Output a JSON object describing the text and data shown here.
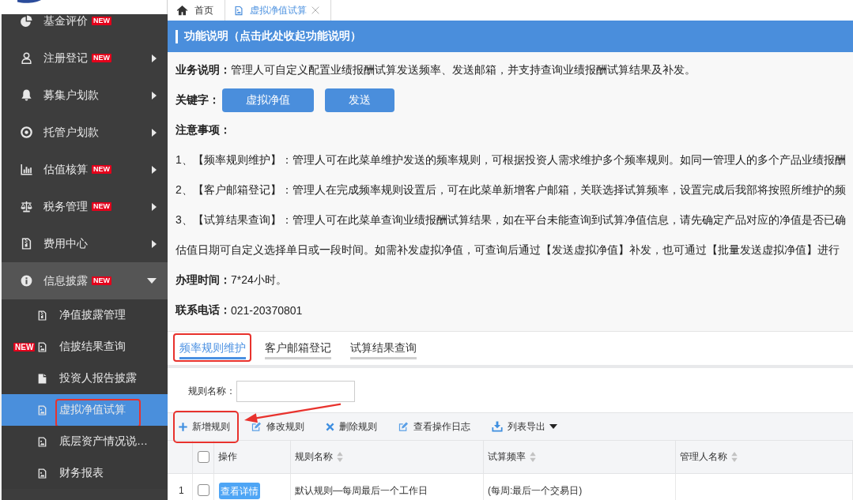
{
  "sidebar": {
    "items": [
      {
        "label": "基金评价",
        "badge": "NEW",
        "kind": "link",
        "expanded": false,
        "selected": false
      },
      {
        "label": "注册登记",
        "badge": "NEW",
        "kind": "group",
        "expanded": false,
        "selected": false
      },
      {
        "label": "募集户划款",
        "kind": "group",
        "expanded": false,
        "selected": false
      },
      {
        "label": "托管户划款",
        "kind": "group",
        "expanded": false,
        "selected": false
      },
      {
        "label": "估值核算",
        "badge": "NEW",
        "kind": "group",
        "expanded": false,
        "selected": false
      },
      {
        "label": "税务管理",
        "badge": "NEW",
        "kind": "group",
        "expanded": false,
        "selected": false
      },
      {
        "label": "费用中心",
        "kind": "group",
        "expanded": false,
        "selected": false
      },
      {
        "label": "信息披露",
        "badge": "NEW",
        "kind": "group",
        "expanded": true,
        "selected": false,
        "children": [
          {
            "label": "净值披露管理",
            "selected": false,
            "marked": false
          },
          {
            "label": "信披结果查询",
            "badge": "NEW",
            "selected": false,
            "marked": false
          },
          {
            "label": "投资人报告披露",
            "selected": false,
            "marked": false
          },
          {
            "label": "虚拟净值试算",
            "selected": true,
            "marked": true
          },
          {
            "label": "底层资产情况说…",
            "selected": false,
            "marked": false
          },
          {
            "label": "财务报表",
            "selected": false,
            "marked": false
          }
        ]
      }
    ]
  },
  "tabs": [
    {
      "label": "首页",
      "selected": false,
      "closable": false
    },
    {
      "label": "虚拟净值试算",
      "selected": true,
      "closable": true
    }
  ],
  "info_panel": {
    "title": "功能说明（点击此处收起功能说明）",
    "business": {
      "label": "业务说明：",
      "text": "管理人可自定义配置业绩报酬试算发送频率、发送邮箱，并支持查询业绩报酬试算结果及补发。"
    },
    "keywords": {
      "label": "关键字：",
      "items": [
        "虚拟净值",
        "发送"
      ]
    },
    "notes_title": "注意事项：",
    "notes": [
      "1、【频率规则维护】：管理人可在此菜单维护发送的频率规则，可根据投资人需求维护多个频率规则。如同一管理人的多个产品业绩报酬",
      "2、【客户邮箱登记】：管理人在完成频率规则设置后，可在此菜单新增客户邮箱，关联选择试算频率，设置完成后我部将按照所维护的频",
      "3、【试算结果查询】：管理人可在此菜单查询业绩报酬试算结果，如在平台未能查询到试算净值信息，请先确定产品对应的净值是否已确",
      "估值日期可自定义选择单日或一段时间。如需补发虚拟净值，可查询后通过【发送虚拟净值】补发，也可通过【批量发送虚拟净值】进行"
    ],
    "hours": {
      "label": "办理时间：",
      "text": "7*24小时。"
    },
    "phone": {
      "label": "联系电话：",
      "text": "021-20370801"
    }
  },
  "rule_section": {
    "tabs": [
      {
        "label": "频率规则维护",
        "selected": true,
        "marked": true
      },
      {
        "label": "客户邮箱登记",
        "selected": false,
        "marked": false
      },
      {
        "label": "试算结果查询",
        "selected": false,
        "marked": false
      }
    ],
    "filter": {
      "label": "规则名称："
    },
    "toolbar": [
      {
        "label": "新增规则",
        "dropdown": false,
        "marked": true,
        "pointed": true
      },
      {
        "label": "修改规则",
        "dropdown": false,
        "marked": false,
        "pointed": false
      },
      {
        "label": "删除规则",
        "dropdown": false,
        "marked": false,
        "pointed": false
      },
      {
        "label": "查看操作日志",
        "dropdown": false,
        "marked": false,
        "pointed": false
      },
      {
        "label": "列表导出",
        "dropdown": true,
        "marked": false,
        "pointed": false
      }
    ],
    "table": {
      "select_all": {
        "checked": false
      },
      "columns": [
        {
          "label": "操作",
          "kind": "action",
          "sortable": false
        },
        {
          "label": "规则名称",
          "kind": "text",
          "sortable": true
        },
        {
          "label": "试算频率",
          "kind": "text",
          "sortable": true
        },
        {
          "label": "管理人名称",
          "kind": "text",
          "sortable": true
        }
      ],
      "rows": [
        {
          "number": "1",
          "checked": false,
          "cells": [
            "查看详情",
            "默认规则—每周最后一个工作日",
            "(每周:最后一个交易日)"
          ]
        }
      ]
    }
  }
}
